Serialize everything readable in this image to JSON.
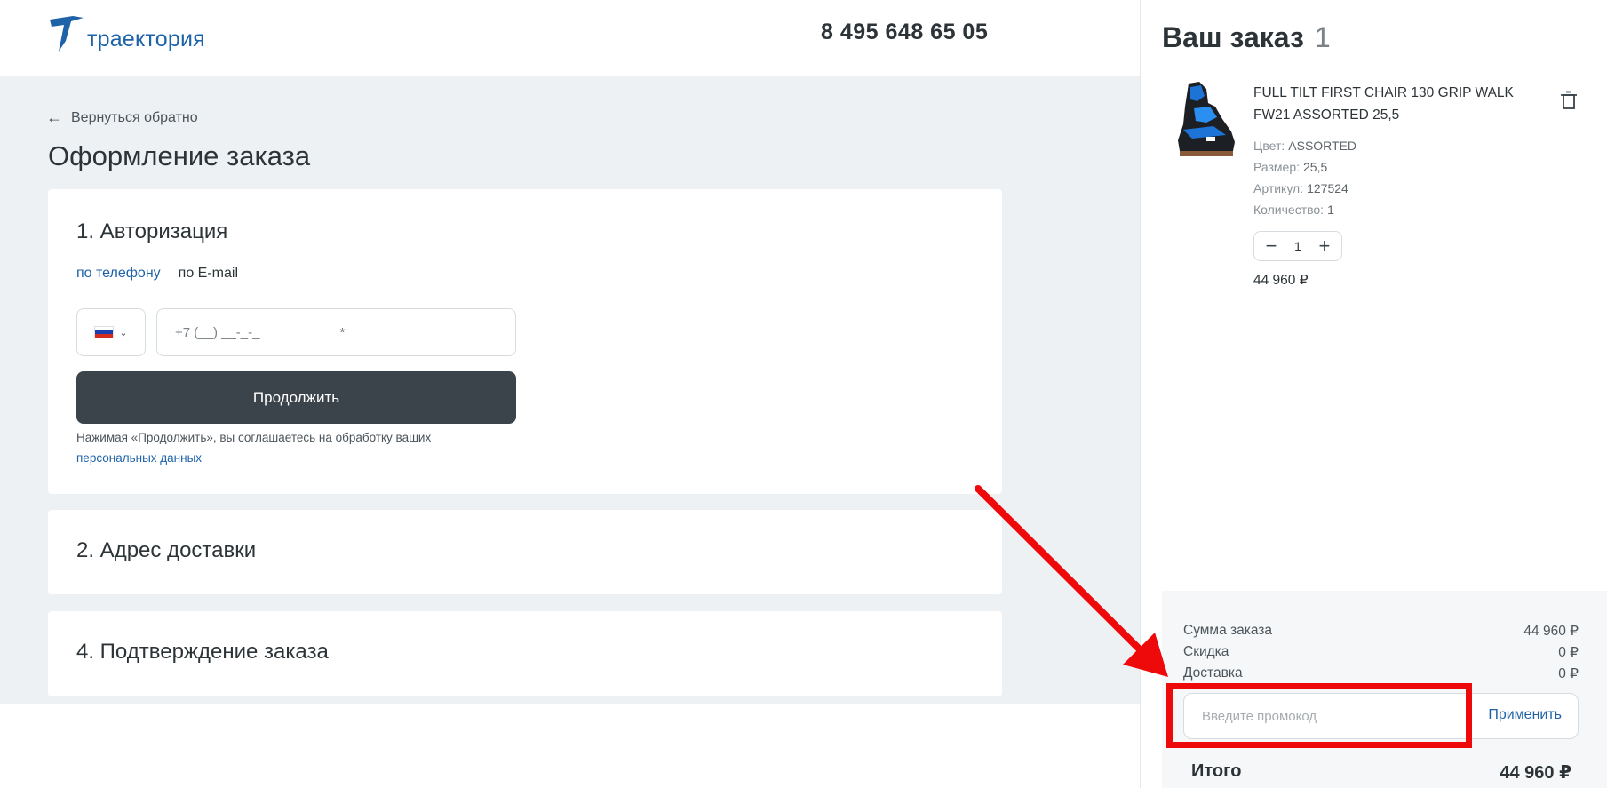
{
  "header": {
    "logo_text": "траектория",
    "phone": "8 495 648 65 05"
  },
  "main": {
    "back_link": "Вернуться обратно",
    "page_title": "Оформление заказа",
    "auth": {
      "title": "1. Авторизация",
      "tabs": [
        "по телефону",
        "по E-mail"
      ],
      "country_flag": "russia-flag-icon",
      "phone_placeholder": "+7 (__) __-_-_",
      "required_mark": "*",
      "continue_label": "Продолжить",
      "consent_text": "Нажимая «Продолжить», вы соглашаетесь на обработку ваших",
      "consent_link": "персональных данных"
    },
    "delivery_title": "2. Адрес доставки",
    "confirm_title": "4. Подтверждение заказа"
  },
  "order": {
    "title": "Ваш заказ",
    "count": "1",
    "item": {
      "name": "FULL TILT FIRST CHAIR 130 GRIP WALK FW21 ASSORTED 25,5",
      "attrs": [
        {
          "label": "Цвет:",
          "value": "ASSORTED"
        },
        {
          "label": "Размер:",
          "value": "25,5"
        },
        {
          "label": "Артикул:",
          "value": "127524"
        },
        {
          "label": "Количество:",
          "value": "1"
        }
      ],
      "quantity": "1",
      "price": "44 960 ₽"
    },
    "summary": {
      "sum_label": "Сумма заказа",
      "sum_value": "44 960 ₽",
      "discount_label": "Скидка",
      "discount_value": "0 ₽",
      "delivery_label": "Доставка",
      "delivery_value": "0 ₽",
      "promo_placeholder": "Введите промокод",
      "apply_label": "Применить",
      "total_label": "Итого",
      "total_value": "44 960 ₽"
    }
  },
  "colors": {
    "accent": "#1e62a8",
    "dark_button": "#3b444a",
    "annotation": "#ee0a0a",
    "page_bg": "#eef1f4"
  }
}
